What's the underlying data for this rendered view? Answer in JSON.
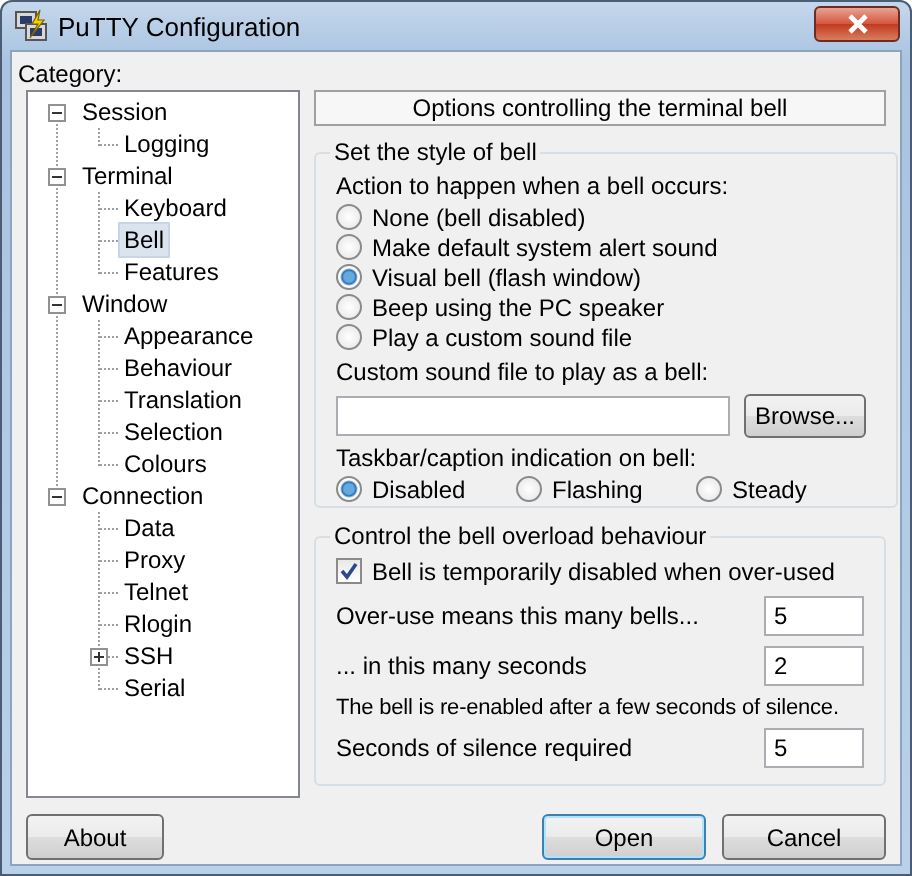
{
  "window": {
    "title": "PuTTY Configuration"
  },
  "category_label": "Category:",
  "tree": [
    {
      "label": "Session",
      "expanded": true,
      "selected": false,
      "children": [
        {
          "label": "Logging",
          "selected": false
        }
      ]
    },
    {
      "label": "Terminal",
      "expanded": true,
      "selected": false,
      "children": [
        {
          "label": "Keyboard",
          "selected": false
        },
        {
          "label": "Bell",
          "selected": true
        },
        {
          "label": "Features",
          "selected": false
        }
      ]
    },
    {
      "label": "Window",
      "expanded": true,
      "selected": false,
      "children": [
        {
          "label": "Appearance",
          "selected": false
        },
        {
          "label": "Behaviour",
          "selected": false
        },
        {
          "label": "Translation",
          "selected": false
        },
        {
          "label": "Selection",
          "selected": false
        },
        {
          "label": "Colours",
          "selected": false
        }
      ]
    },
    {
      "label": "Connection",
      "expanded": true,
      "selected": false,
      "children": [
        {
          "label": "Data",
          "selected": false
        },
        {
          "label": "Proxy",
          "selected": false
        },
        {
          "label": "Telnet",
          "selected": false
        },
        {
          "label": "Rlogin",
          "selected": false
        },
        {
          "label": "SSH",
          "selected": false,
          "expanded": false
        },
        {
          "label": "Serial",
          "selected": false
        }
      ]
    }
  ],
  "panel_header": "Options controlling the terminal bell",
  "bell_style": {
    "title": "Set the style of bell",
    "action_label": "Action to happen when a bell occurs:",
    "actions": [
      {
        "label": "None (bell disabled)",
        "selected": false
      },
      {
        "label": "Make default system alert sound",
        "selected": false
      },
      {
        "label": "Visual bell (flash window)",
        "selected": true
      },
      {
        "label": "Beep using the PC speaker",
        "selected": false
      },
      {
        "label": "Play a custom sound file",
        "selected": false
      }
    ],
    "sound_file_label": "Custom sound file to play as a bell:",
    "browse_button": "Browse...",
    "taskbar_label": "Taskbar/caption indication on bell:",
    "taskbar_options": [
      {
        "label": "Disabled",
        "selected": true
      },
      {
        "label": "Flashing",
        "selected": false
      },
      {
        "label": "Steady",
        "selected": false
      }
    ]
  },
  "overload": {
    "title": "Control the bell overload behaviour",
    "checkbox": {
      "label": "Bell is temporarily disabled when over-used",
      "checked": true
    },
    "fields": [
      {
        "label": "Over-use means this many bells...",
        "value": "5"
      },
      {
        "label": "... in this many seconds",
        "value": "2"
      }
    ],
    "note": "The bell is re-enabled after a few seconds of silence.",
    "silence_field": {
      "label": "Seconds of silence required",
      "value": "5"
    }
  },
  "buttons": [
    {
      "label": "About",
      "default": false
    },
    {
      "label": "Open",
      "default": true
    },
    {
      "label": "Cancel",
      "default": false
    }
  ]
}
